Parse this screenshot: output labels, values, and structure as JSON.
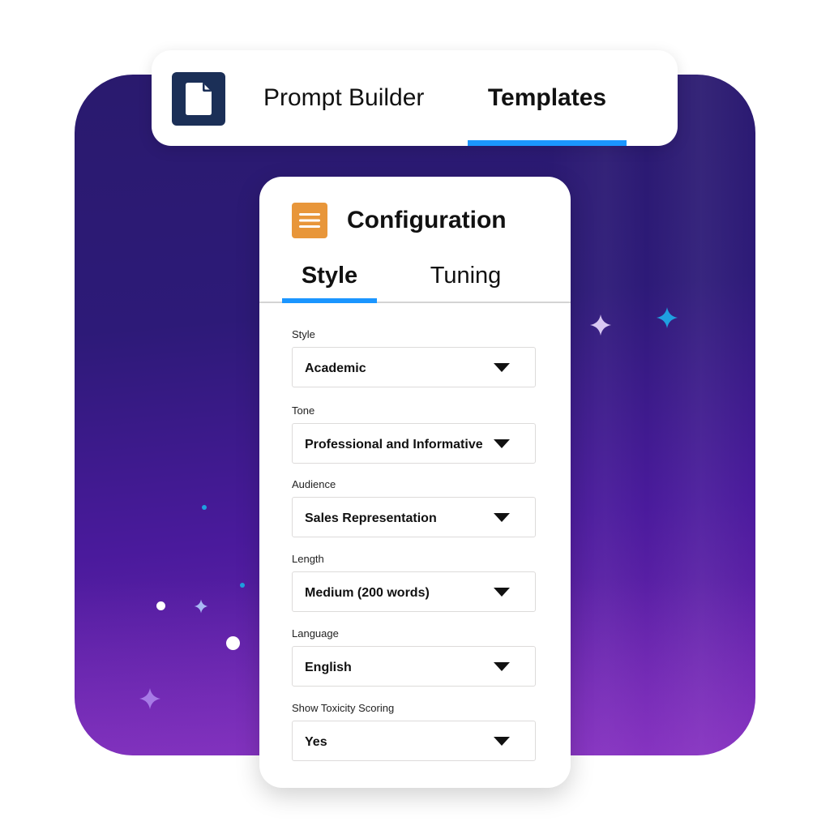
{
  "header": {
    "app_icon": "document-icon",
    "tabs": [
      {
        "label": "Prompt Builder",
        "active": false
      },
      {
        "label": "Templates",
        "active": true
      }
    ]
  },
  "config_panel": {
    "icon": "menu-lines-icon",
    "title": "Configuration",
    "tabs": [
      {
        "label": "Style",
        "active": true
      },
      {
        "label": "Tuning",
        "active": false
      }
    ],
    "fields": [
      {
        "label": "Style",
        "value": "Academic"
      },
      {
        "label": "Tone",
        "value": "Professional and Informative"
      },
      {
        "label": "Audience",
        "value": "Sales Representation"
      },
      {
        "label": "Length",
        "value": "Medium (200 words)"
      },
      {
        "label": "Language",
        "value": "English"
      },
      {
        "label": "Show Toxicity Scoring",
        "value": "Yes"
      }
    ]
  },
  "colors": {
    "accent": "#1b96ff",
    "app_icon_bg": "#1b2f57",
    "config_icon_bg": "#e8963a",
    "background_gradient": [
      "#2a1a6e",
      "#7a2ab8"
    ]
  }
}
